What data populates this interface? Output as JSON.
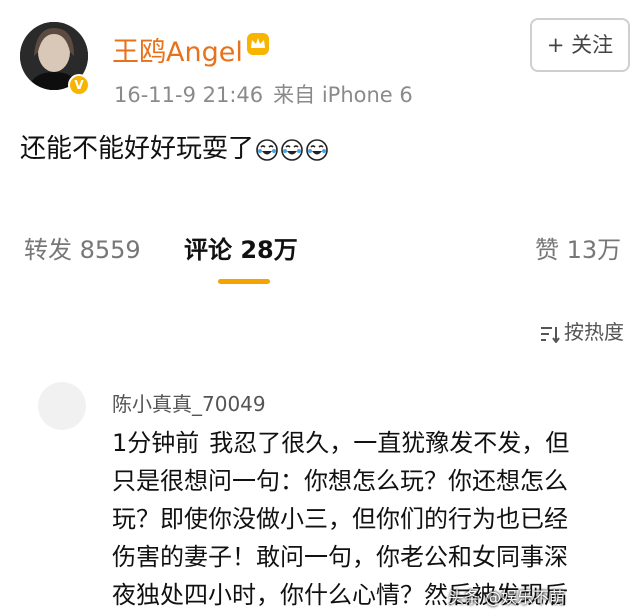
{
  "post": {
    "username": "王鸥Angel",
    "date": "16-11-9 21:46",
    "source": "来自 iPhone 6",
    "follow_label": "+ 关注",
    "text": "还能不能好好玩耍了",
    "emoji_icons": [
      "laugh-cry-emoji",
      "laugh-cry-emoji",
      "laugh-cry-emoji"
    ]
  },
  "tabs": {
    "repost": "转发 8559",
    "comment": "评论 28万",
    "like": "赞 13万"
  },
  "sort_label": "按热度",
  "comment": {
    "user": "陈小真真_70049",
    "time": "1分钟前",
    "lines": [
      "我忍了很久，一直犹豫发不发，但",
      "只是很想问一句：你想怎么玩？你还想怎么",
      "玩？即使你没做小三，但你们的行为也已经",
      "伤害的妻子！敢问一句，你老公和女同事深",
      "夜独处四小时，你什么心情？然后被发现后"
    ]
  },
  "watermark": "头条 @娱乐不萌"
}
